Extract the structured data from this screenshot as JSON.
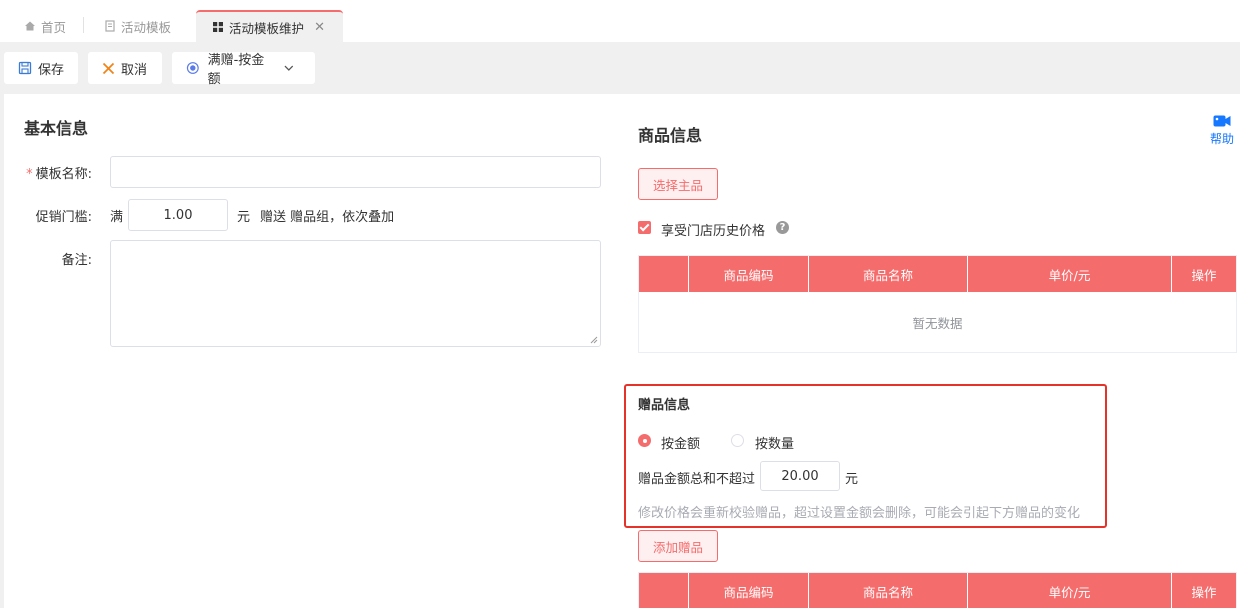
{
  "tabs": [
    {
      "label": "首页",
      "icon": "home-icon"
    },
    {
      "label": "活动模板",
      "icon": "document-icon"
    },
    {
      "label": "活动模板维护",
      "icon": "grid-icon",
      "active": true
    }
  ],
  "toolbar": {
    "save_label": "保存",
    "cancel_label": "取消",
    "type_label": "满赠-按金额"
  },
  "basic": {
    "title": "基本信息",
    "name_label": "模板名称:",
    "name_value": "",
    "threshold_label": "促销门槛:",
    "threshold_prefix": "满",
    "threshold_value": "1.00",
    "threshold_suffix": "元",
    "threshold_desc": "赠送 赠品组，依次叠加",
    "remark_label": "备注:",
    "remark_value": ""
  },
  "goods": {
    "title": "商品信息",
    "select_button": "选择主品",
    "history_price_label": "享受门店历史价格",
    "history_price_checked": true,
    "columns": [
      "",
      "商品编码",
      "商品名称",
      "单价/元",
      "操作"
    ],
    "empty_text": "暂无数据"
  },
  "gift": {
    "title": "赠品信息",
    "mode_options": [
      "按金额",
      "按数量"
    ],
    "mode_selected": "按金额",
    "limit_label": "赠品金额总和不超过",
    "limit_value": "20.00",
    "limit_unit": "元",
    "hint": "修改价格会重新校验赠品，超过设置金额会删除，可能会引起下方赠品的变化",
    "add_button": "添加赠品",
    "columns": [
      "",
      "商品编码",
      "商品名称",
      "单价/元",
      "操作"
    ]
  },
  "help": {
    "label": "帮助",
    "icon": "video-icon"
  },
  "colors": {
    "accent": "#f56c6c",
    "highlight_box": "#e6332a",
    "help": "#1677ff"
  }
}
